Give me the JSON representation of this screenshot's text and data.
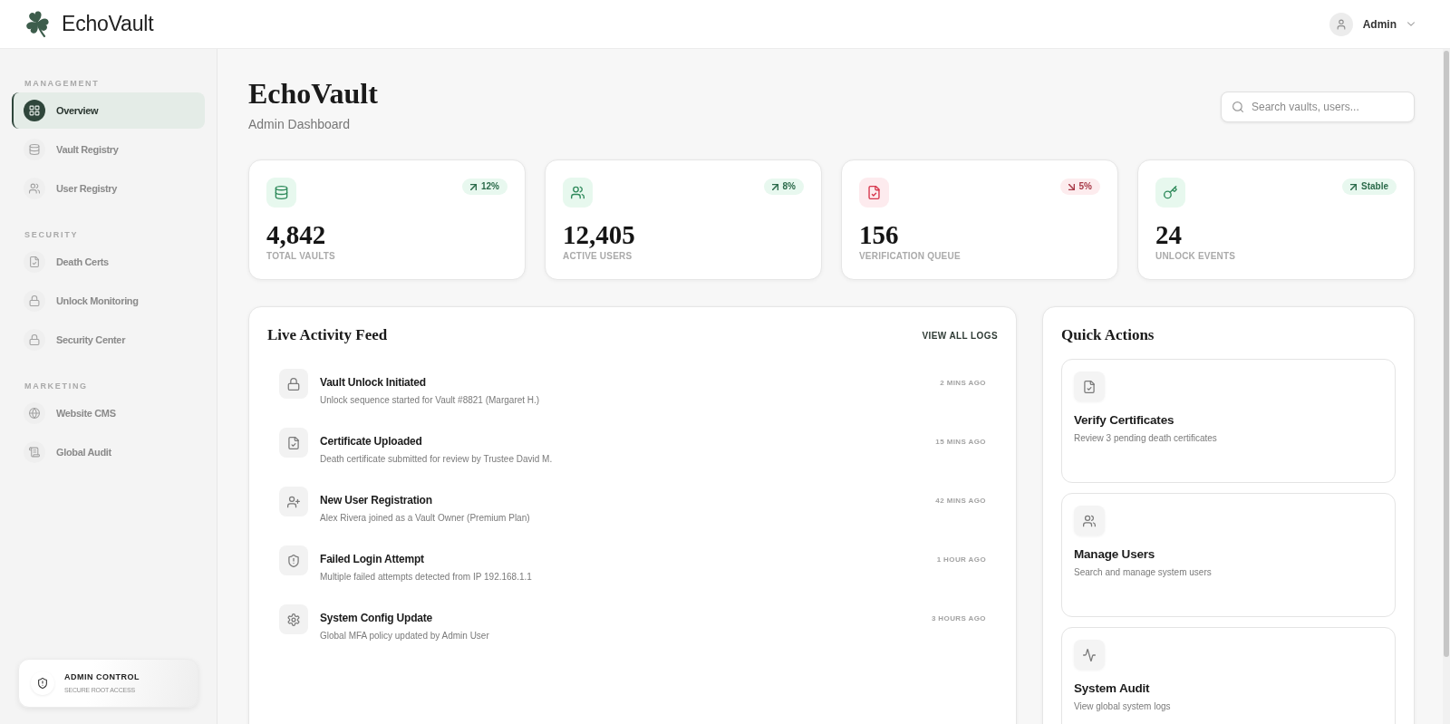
{
  "header": {
    "brand": "EchoVault",
    "user": {
      "name": "Admin"
    }
  },
  "sidebar": {
    "sections": [
      {
        "label": "MANAGEMENT",
        "items": [
          {
            "label": "Overview",
            "selected": true
          },
          {
            "label": "Vault Registry",
            "selected": false
          },
          {
            "label": "User Registry",
            "selected": false
          }
        ]
      },
      {
        "label": "SECURITY",
        "items": [
          {
            "label": "Death Certs",
            "selected": false
          },
          {
            "label": "Unlock Monitoring",
            "selected": false
          },
          {
            "label": "Security Center",
            "selected": false
          }
        ]
      },
      {
        "label": "MARKETING",
        "items": [
          {
            "label": "Website CMS",
            "selected": false
          },
          {
            "label": "Global Audit",
            "selected": false
          }
        ]
      }
    ],
    "footer": {
      "title": "ADMIN CONTROL",
      "subtitle": "SECURE ROOT ACCESS"
    }
  },
  "page": {
    "title": "EchoVault",
    "subtitle": "Admin Dashboard",
    "search": {
      "placeholder": "Search vaults, users..."
    }
  },
  "stats": [
    {
      "kind": "rise",
      "value": "4,842",
      "label": "TOTAL VAULTS",
      "change": "12%"
    },
    {
      "kind": "rise",
      "value": "12,405",
      "label": "ACTIVE USERS",
      "change": "8%"
    },
    {
      "kind": "fall",
      "value": "156",
      "label": "VERIFICATION QUEUE",
      "change": "5%"
    },
    {
      "kind": "rise",
      "value": "24",
      "label": "UNLOCK EVENTS",
      "change": "Stable"
    }
  ],
  "activity_feed": {
    "title": "Live Activity Feed",
    "link": "VIEW ALL LOGS",
    "items": [
      {
        "title": "Vault Unlock Initiated",
        "description": "Unlock sequence started for Vault #8821 (Margaret H.)",
        "time": "2 MINS AGO"
      },
      {
        "title": "Certificate Uploaded",
        "description": "Death certificate submitted for review by Trustee David M.",
        "time": "15 MINS AGO"
      },
      {
        "title": "New User Registration",
        "description": "Alex Rivera joined as a Vault Owner (Premium Plan)",
        "time": "42 MINS AGO"
      },
      {
        "title": "Failed Login Attempt",
        "description": "Multiple failed attempts detected from IP 192.168.1.1",
        "time": "1 HOUR AGO"
      },
      {
        "title": "System Config Update",
        "description": "Global MFA policy updated by Admin User",
        "time": "3 HOURS AGO"
      }
    ]
  },
  "quick_actions": {
    "title": "Quick Actions",
    "items": [
      {
        "title": "Verify Certificates",
        "description": "Review 3 pending death certificates"
      },
      {
        "title": "Manage Users",
        "description": "Search and manage system users"
      },
      {
        "title": "System Audit",
        "description": "View global system logs"
      }
    ]
  }
}
